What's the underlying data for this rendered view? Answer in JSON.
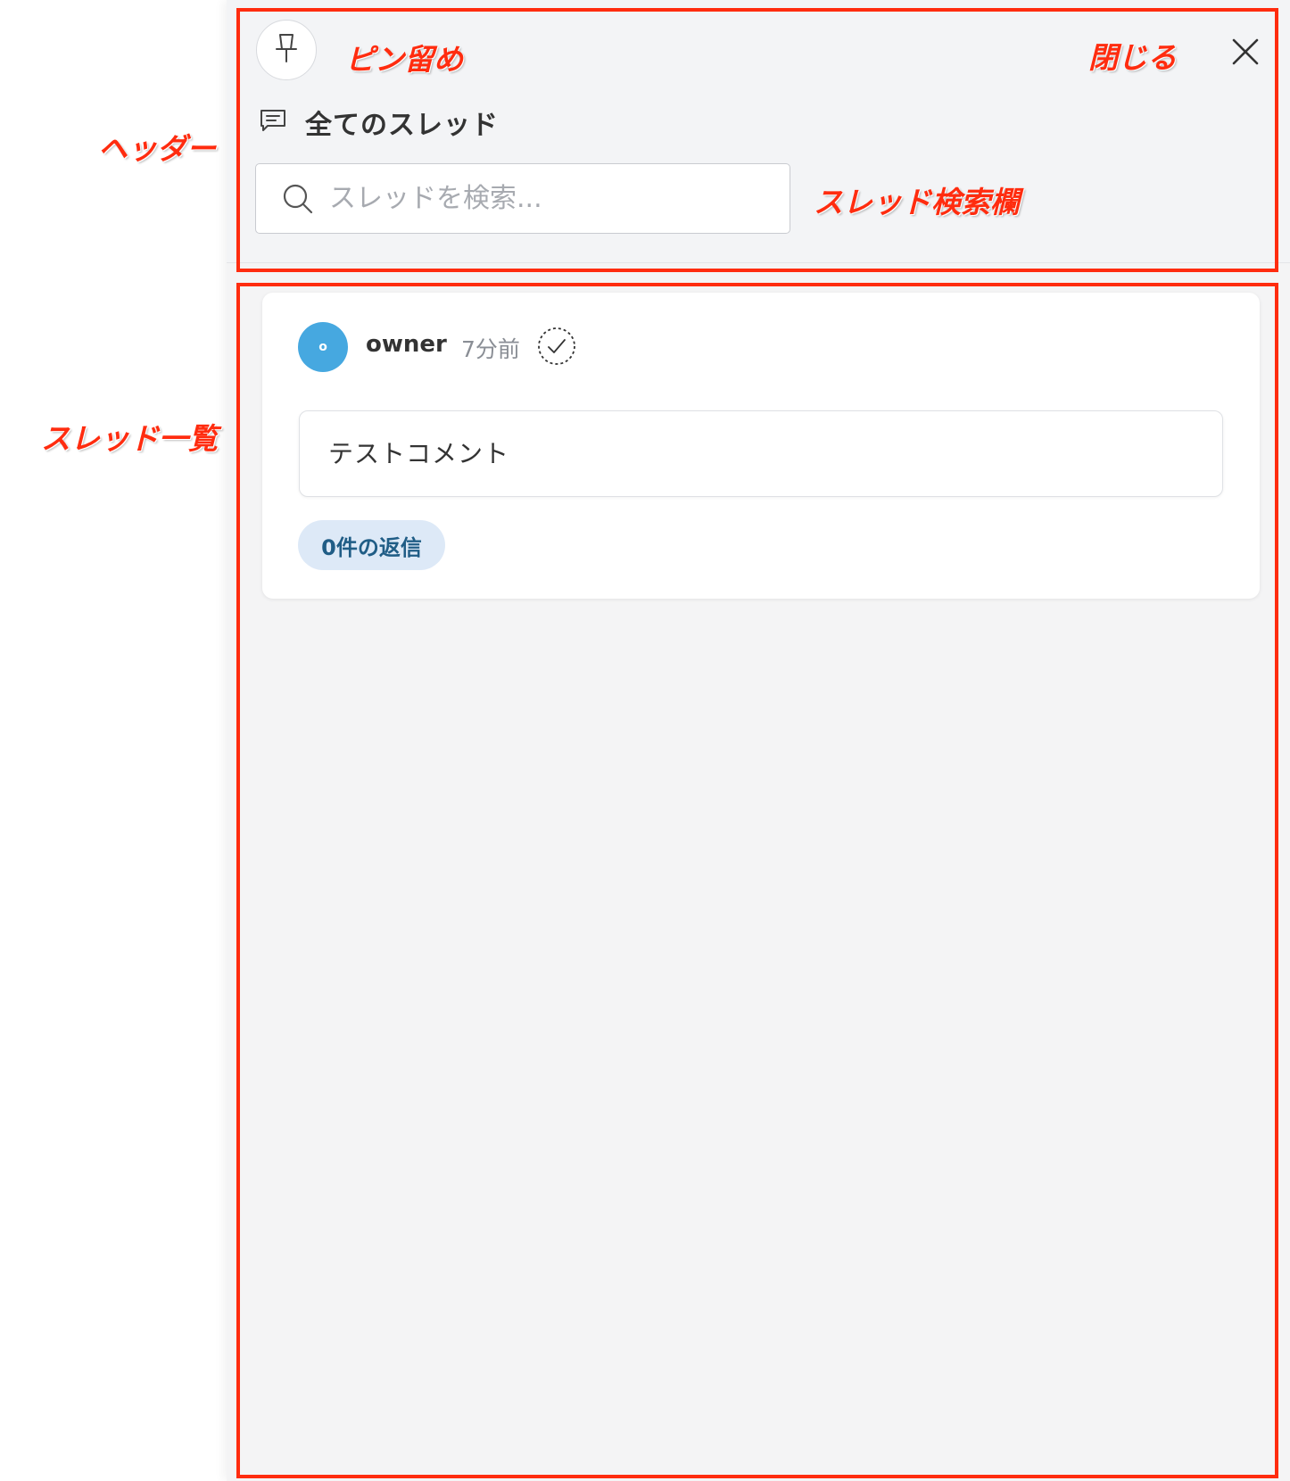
{
  "header": {
    "title": "全てのスレッド",
    "search_placeholder": "スレッドを検索..."
  },
  "threads": [
    {
      "author": "owner",
      "avatar_initial": "o",
      "time": "7分前",
      "comment": "テストコメント",
      "replies_label": "0件の返信"
    }
  ],
  "annotations": {
    "pin": "ピン留め",
    "close": "閉じる",
    "header": "ヘッダー",
    "search": "スレッド検索欄",
    "list": "スレッド一覧"
  },
  "colors": {
    "annotation": "#ff2c0f",
    "avatar": "#46a8e0",
    "reply_chip_bg": "#dde9f7",
    "reply_chip_text": "#205d86"
  }
}
